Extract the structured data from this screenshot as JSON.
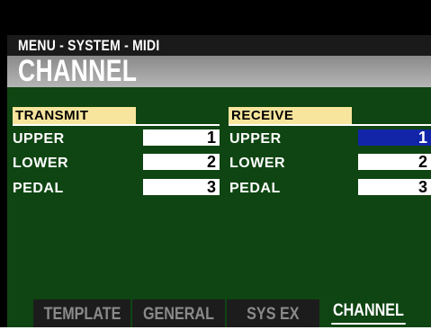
{
  "header": {
    "menu_path": "MENU - SYSTEM - MIDI",
    "title": "CHANNEL"
  },
  "transmit": {
    "heading": "TRANSMIT",
    "rows": [
      {
        "label": "UPPER",
        "value": "1"
      },
      {
        "label": "LOWER",
        "value": "2"
      },
      {
        "label": "PEDAL",
        "value": "3"
      }
    ]
  },
  "receive": {
    "heading": "RECEIVE",
    "rows": [
      {
        "label": "UPPER",
        "value": "1",
        "selected": true
      },
      {
        "label": "LOWER",
        "value": "2"
      },
      {
        "label": "PEDAL",
        "value": "3"
      }
    ]
  },
  "tabs": [
    {
      "label": "TEMPLATE",
      "active": false
    },
    {
      "label": "GENERAL",
      "active": false
    },
    {
      "label": "SYS EX",
      "active": false
    },
    {
      "label": "CHANNEL",
      "active": true
    }
  ],
  "colors": {
    "panel": "#0f4512",
    "section_header": "#f7e59d",
    "selection": "#1225a8"
  }
}
